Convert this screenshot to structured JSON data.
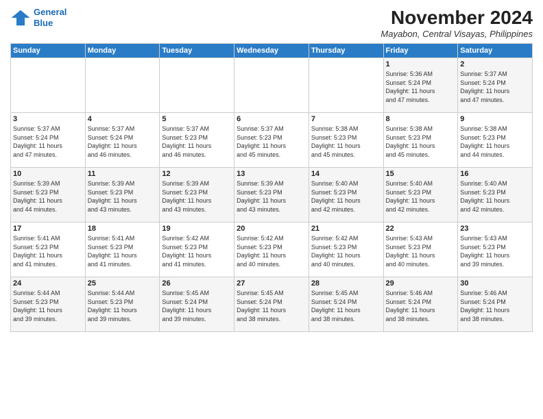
{
  "logo": {
    "line1": "General",
    "line2": "Blue"
  },
  "title": "November 2024",
  "location": "Mayabon, Central Visayas, Philippines",
  "weekdays": [
    "Sunday",
    "Monday",
    "Tuesday",
    "Wednesday",
    "Thursday",
    "Friday",
    "Saturday"
  ],
  "weeks": [
    [
      {
        "day": "",
        "info": ""
      },
      {
        "day": "",
        "info": ""
      },
      {
        "day": "",
        "info": ""
      },
      {
        "day": "",
        "info": ""
      },
      {
        "day": "",
        "info": ""
      },
      {
        "day": "1",
        "info": "Sunrise: 5:36 AM\nSunset: 5:24 PM\nDaylight: 11 hours\nand 47 minutes."
      },
      {
        "day": "2",
        "info": "Sunrise: 5:37 AM\nSunset: 5:24 PM\nDaylight: 11 hours\nand 47 minutes."
      }
    ],
    [
      {
        "day": "3",
        "info": "Sunrise: 5:37 AM\nSunset: 5:24 PM\nDaylight: 11 hours\nand 47 minutes."
      },
      {
        "day": "4",
        "info": "Sunrise: 5:37 AM\nSunset: 5:24 PM\nDaylight: 11 hours\nand 46 minutes."
      },
      {
        "day": "5",
        "info": "Sunrise: 5:37 AM\nSunset: 5:23 PM\nDaylight: 11 hours\nand 46 minutes."
      },
      {
        "day": "6",
        "info": "Sunrise: 5:37 AM\nSunset: 5:23 PM\nDaylight: 11 hours\nand 45 minutes."
      },
      {
        "day": "7",
        "info": "Sunrise: 5:38 AM\nSunset: 5:23 PM\nDaylight: 11 hours\nand 45 minutes."
      },
      {
        "day": "8",
        "info": "Sunrise: 5:38 AM\nSunset: 5:23 PM\nDaylight: 11 hours\nand 45 minutes."
      },
      {
        "day": "9",
        "info": "Sunrise: 5:38 AM\nSunset: 5:23 PM\nDaylight: 11 hours\nand 44 minutes."
      }
    ],
    [
      {
        "day": "10",
        "info": "Sunrise: 5:39 AM\nSunset: 5:23 PM\nDaylight: 11 hours\nand 44 minutes."
      },
      {
        "day": "11",
        "info": "Sunrise: 5:39 AM\nSunset: 5:23 PM\nDaylight: 11 hours\nand 43 minutes."
      },
      {
        "day": "12",
        "info": "Sunrise: 5:39 AM\nSunset: 5:23 PM\nDaylight: 11 hours\nand 43 minutes."
      },
      {
        "day": "13",
        "info": "Sunrise: 5:39 AM\nSunset: 5:23 PM\nDaylight: 11 hours\nand 43 minutes."
      },
      {
        "day": "14",
        "info": "Sunrise: 5:40 AM\nSunset: 5:23 PM\nDaylight: 11 hours\nand 42 minutes."
      },
      {
        "day": "15",
        "info": "Sunrise: 5:40 AM\nSunset: 5:23 PM\nDaylight: 11 hours\nand 42 minutes."
      },
      {
        "day": "16",
        "info": "Sunrise: 5:40 AM\nSunset: 5:23 PM\nDaylight: 11 hours\nand 42 minutes."
      }
    ],
    [
      {
        "day": "17",
        "info": "Sunrise: 5:41 AM\nSunset: 5:23 PM\nDaylight: 11 hours\nand 41 minutes."
      },
      {
        "day": "18",
        "info": "Sunrise: 5:41 AM\nSunset: 5:23 PM\nDaylight: 11 hours\nand 41 minutes."
      },
      {
        "day": "19",
        "info": "Sunrise: 5:42 AM\nSunset: 5:23 PM\nDaylight: 11 hours\nand 41 minutes."
      },
      {
        "day": "20",
        "info": "Sunrise: 5:42 AM\nSunset: 5:23 PM\nDaylight: 11 hours\nand 40 minutes."
      },
      {
        "day": "21",
        "info": "Sunrise: 5:42 AM\nSunset: 5:23 PM\nDaylight: 11 hours\nand 40 minutes."
      },
      {
        "day": "22",
        "info": "Sunrise: 5:43 AM\nSunset: 5:23 PM\nDaylight: 11 hours\nand 40 minutes."
      },
      {
        "day": "23",
        "info": "Sunrise: 5:43 AM\nSunset: 5:23 PM\nDaylight: 11 hours\nand 39 minutes."
      }
    ],
    [
      {
        "day": "24",
        "info": "Sunrise: 5:44 AM\nSunset: 5:23 PM\nDaylight: 11 hours\nand 39 minutes."
      },
      {
        "day": "25",
        "info": "Sunrise: 5:44 AM\nSunset: 5:23 PM\nDaylight: 11 hours\nand 39 minutes."
      },
      {
        "day": "26",
        "info": "Sunrise: 5:45 AM\nSunset: 5:24 PM\nDaylight: 11 hours\nand 39 minutes."
      },
      {
        "day": "27",
        "info": "Sunrise: 5:45 AM\nSunset: 5:24 PM\nDaylight: 11 hours\nand 38 minutes."
      },
      {
        "day": "28",
        "info": "Sunrise: 5:45 AM\nSunset: 5:24 PM\nDaylight: 11 hours\nand 38 minutes."
      },
      {
        "day": "29",
        "info": "Sunrise: 5:46 AM\nSunset: 5:24 PM\nDaylight: 11 hours\nand 38 minutes."
      },
      {
        "day": "30",
        "info": "Sunrise: 5:46 AM\nSunset: 5:24 PM\nDaylight: 11 hours\nand 38 minutes."
      }
    ]
  ]
}
